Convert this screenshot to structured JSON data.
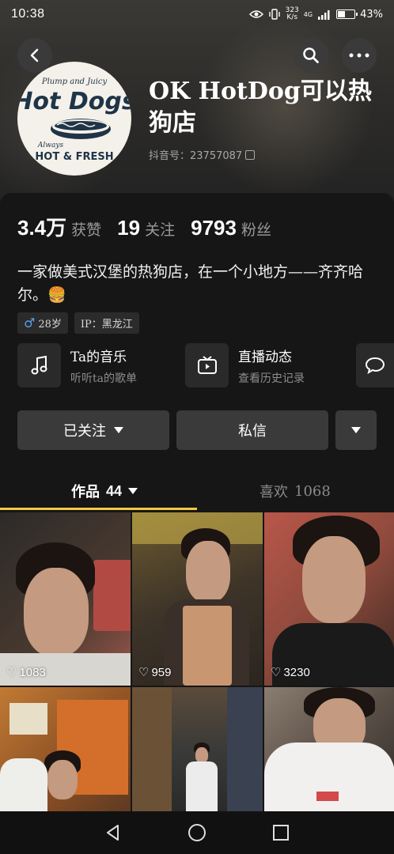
{
  "status_bar": {
    "time": "10:38",
    "net_speed_value": "323",
    "net_speed_unit": "K/s",
    "signal_label": "4G",
    "battery_percent_label": "43%",
    "battery_level": 0.43
  },
  "profile": {
    "nickname": "OK HotDog可以热狗店",
    "douyin_id": "抖音号：23757087",
    "avatar_logo_lines": [
      "Plump and Juicy",
      "Hot Dogs",
      "Always",
      "HOT & FRESH"
    ]
  },
  "stats": {
    "likes_value": "3.4万",
    "likes_label": "获赞",
    "following_value": "19",
    "following_label": "关注",
    "followers_value": "9793",
    "followers_label": "粉丝"
  },
  "bio": "一家做美式汉堡的热狗店，在一个小地方——齐齐哈尔。🍔",
  "tags": {
    "age": "28岁",
    "ip": "IP：黑龙江"
  },
  "features": [
    {
      "title": "Ta的音乐",
      "subtitle": "听听ta的歌单",
      "icon": "music-note-icon"
    },
    {
      "title": "直播动态",
      "subtitle": "查看历史记录",
      "icon": "tv-play-icon"
    }
  ],
  "actions": {
    "follow_label": "已关注",
    "message_label": "私信"
  },
  "tabs": {
    "works_label": "作品",
    "works_count": "44",
    "likes_label": "喜欢",
    "likes_count": "1068"
  },
  "videos": [
    {
      "likes": "1083"
    },
    {
      "likes": "959"
    },
    {
      "likes": "3230"
    },
    {
      "likes": ""
    },
    {
      "likes": ""
    },
    {
      "likes": ""
    }
  ],
  "colors": {
    "background": "#161616",
    "accent_underline": "#f5c945",
    "button_bg": "#3a3a3a",
    "muted_text": "#9a9a9a",
    "male_icon": "#5ba3f5"
  }
}
